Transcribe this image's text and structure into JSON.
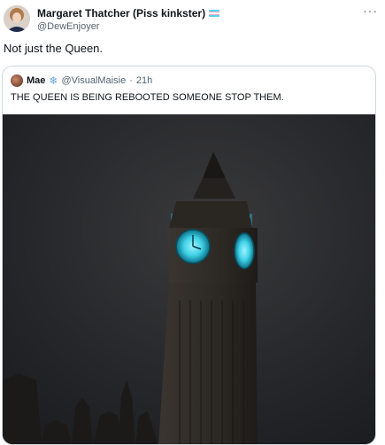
{
  "tweet": {
    "display_name": "Margaret Thatcher (Piss kinkster)",
    "handle": "@DewEnjoyer",
    "text": "Not just the Queen.",
    "more_label": "···"
  },
  "quoted": {
    "display_name": "Mae",
    "badge_icon": "snowflake-icon",
    "handle": "@VisualMaisie",
    "separator": "·",
    "time": "21h",
    "text": "THE QUEEN IS BEING REBOOTED SOMEONE STOP THEM."
  },
  "colors": {
    "flag": [
      "#5bcefa",
      "#f5a9b8",
      "#ffffff",
      "#f5a9b8",
      "#5bcefa"
    ],
    "clock_glow": "#3fd0e6",
    "sky": "#2a2b2e"
  }
}
